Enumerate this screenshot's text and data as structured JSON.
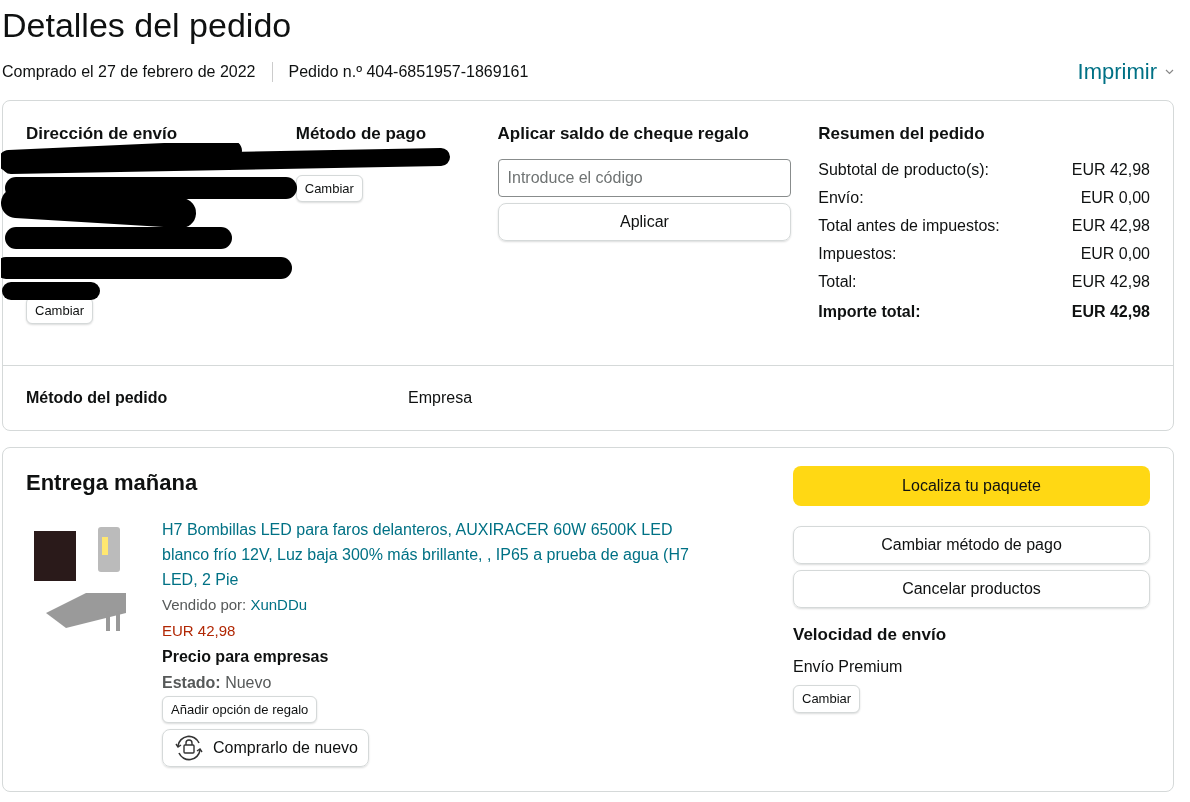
{
  "title": "Detalles del pedido",
  "purchased": "Comprado el 27 de febrero de 2022",
  "order_number": "Pedido n.º 404-6851957-1869161",
  "print_link": "Imprimir",
  "shipping_address": {
    "heading": "Dirección de envío",
    "button": "Cambiar"
  },
  "payment_method": {
    "heading": "Método de pago",
    "button": "Cambiar"
  },
  "gift_card": {
    "heading": "Aplicar saldo de cheque regalo",
    "placeholder": "Introduce el código",
    "button": "Aplicar"
  },
  "summary": {
    "heading": "Resumen del pedido",
    "rows": [
      {
        "label": "Subtotal de producto(s):",
        "value": "EUR 42,98",
        "bold": false
      },
      {
        "label": "Envío:",
        "value": "EUR 0,00",
        "bold": false
      },
      {
        "label": "Total antes de impuestos:",
        "value": "EUR 42,98",
        "bold": false
      },
      {
        "label": "Impuestos:",
        "value": "EUR 0,00",
        "bold": false
      },
      {
        "label": "Total:",
        "value": "EUR 42,98",
        "bold": false
      },
      {
        "label": "Importe total:",
        "value": "EUR 42,98",
        "bold": true
      }
    ]
  },
  "order_method": {
    "label": "Método del pedido",
    "value": "Empresa"
  },
  "delivery": {
    "heading": "Entrega mañana",
    "product": {
      "title": "H7 Bombillas LED para faros delanteros, AUXIRACER 60W 6500K LED blanco frío 12V, Luz baja 300% más brillante, , IP65 a prueba de agua (H7 LED, 2 Pie",
      "seller_label": "Vendido por:",
      "seller": "XunDDu",
      "price": "EUR 42,98",
      "business_price": "Precio para empresas",
      "condition_label": "Estado:",
      "condition": "Nuevo",
      "gift_button": "Añadir opción de regalo",
      "buy_again_button": "Comprarlo de nuevo"
    },
    "track_button": "Localiza tu paquete",
    "actions": [
      "Cambiar método de pago",
      "Cancelar productos"
    ],
    "speed_heading": "Velocidad de envío",
    "speed": "Envío Premium",
    "speed_button": "Cambiar"
  }
}
